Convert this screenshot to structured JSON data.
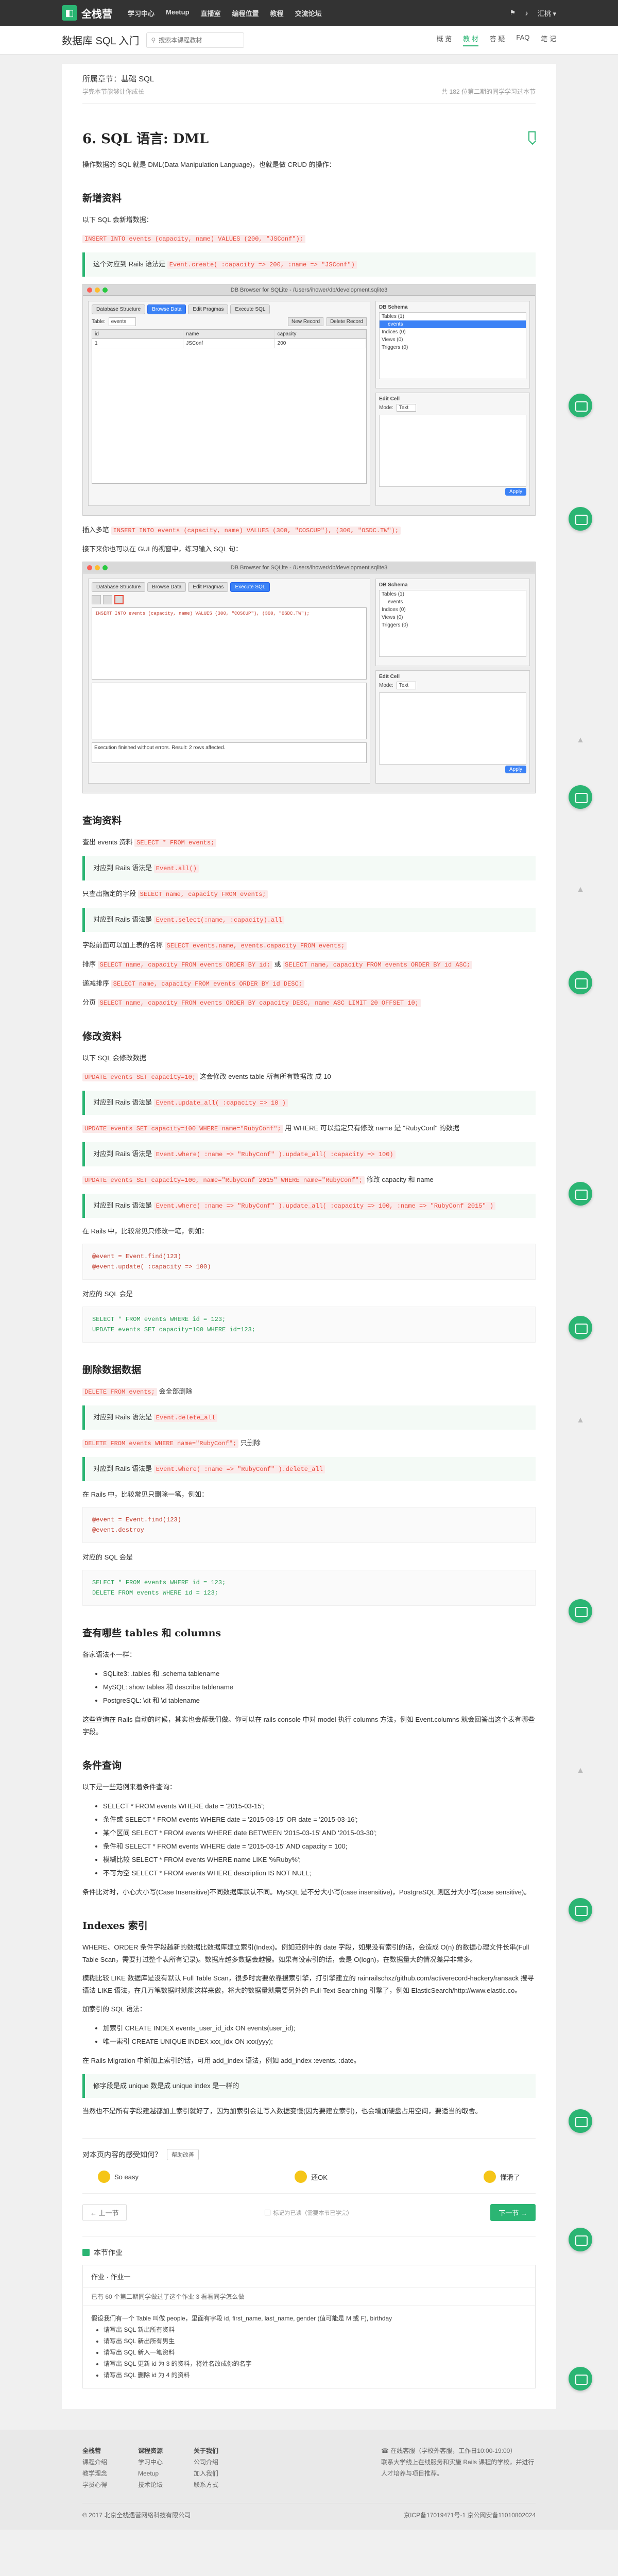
{
  "topbar": {
    "brand": "全栈营",
    "nav": [
      "学习中心",
      "Meetup",
      "直播室",
      "编程位置",
      "教程",
      "交流论坛"
    ],
    "right": [
      "⚑",
      "♪",
      "汇桃 ▾"
    ]
  },
  "subbar": {
    "course_title": "数据库 SQL 入门",
    "search_placeholder": "搜索本课程教材",
    "tabs": [
      "概 览",
      "教 材",
      "答 疑",
      "FAQ",
      "笔 记"
    ]
  },
  "chapter": {
    "name": "所属章节：基础 SQL",
    "sub": "学完本节能够让你成长",
    "stat": "共 182 位第二期的同学学习过本节"
  },
  "article": {
    "title": "6. SQL 语言: DML",
    "intro": "操作数据的 SQL 就是 DML(Data Manipulation Language)，也就是做 CRUD 的操作：",
    "s_insert": "新增资料",
    "insert_p1": "以下 SQL 会新增数据：",
    "insert_code1": "INSERT INTO events (capacity, name) VALUES (200, \"JSConf\");",
    "insert_note_pre": "这个对应到 Rails 语法是",
    "insert_note_code": "Event.create( :capacity => 200, :name => \"JSConf\")",
    "insert_p2_pre": "插入多笔",
    "insert_p2_code": "INSERT INTO events (capacity, name) VALUES (300, \"COSCUP\"), (300, \"OSDC.TW\");",
    "insert_p3": "接下来你也可以在 GUI 的视窗中，练习输入 SQL 句：",
    "s_query": "查询资料",
    "q1_pre": "查出 events 资料",
    "q1_code": "SELECT * FROM events;",
    "q2_pre": "对应到 Rails 语法是",
    "q2_code": "Event.all()",
    "q3_pre": "只查出指定的字段",
    "q3_code": "SELECT name, capacity FROM events;",
    "q4_pre": "对应到 Rails 语法是",
    "q4_code": "Event.select(:name, :capacity).all",
    "q5_pre": "字段前面可以加上表的名称",
    "q5_code": "SELECT events.name, events.capacity FROM events;",
    "q6_pre": "排序",
    "q6_code1": "SELECT name, capacity FROM events ORDER BY id;",
    "q6_mid": "或",
    "q6_code2": "SELECT name, capacity FROM events ORDER BY id ASC;",
    "q7_pre": "递减排序",
    "q7_code": "SELECT name, capacity FROM events ORDER BY id DESC;",
    "q8_pre": "分页",
    "q8_code": "SELECT name, capacity FROM events ORDER BY capacity DESC, name ASC LIMIT 20 OFFSET 10;",
    "s_update": "修改资料",
    "u1": "以下 SQL 会修改数据",
    "u2_code": "UPDATE events SET capacity=10;",
    "u2_post": "这会修改 events table 所有所有数据改 成 10",
    "u3_pre": "对应到 Rails 语法是",
    "u3_code": "Event.update_all( :capacity => 10 )",
    "u4_code": "UPDATE events SET capacity=100 WHERE name=\"RubyConf\";",
    "u4_post": "用 WHERE 可以指定只有修改 name 是 \"RubyConf\" 的数据",
    "u5_pre": "对应到 Rails 语法是",
    "u5_code": "Event.where( :name => \"RubyConf\" ).update_all( :capacity => 100)",
    "u6_code": "UPDATE events SET capacity=100, name=\"RubyConf 2015\" WHERE name=\"RubyConf\";",
    "u6_post": "修改 capacity 和 name",
    "u7_pre": "对应到 Rails 语法是",
    "u7_code": "Event.where( :name => \"RubyConf\" ).update_all( :capacity => 100, :name => \"RubyConf 2015\" )",
    "u8": "在 Rails 中，比较常见只修改一笔，例如：",
    "u8_pre": "@event = Event.find(123)\n@event.update( :capacity => 100)",
    "u9": "对应的 SQL 会是",
    "u9_pre": "SELECT * FROM events WHERE id = 123;\nUPDATE events SET capacity=100 WHERE id=123;",
    "s_delete": "删除数据数据",
    "d1_code": "DELETE FROM events;",
    "d1_post": "会全部删除",
    "d2_pre": "对应到 Rails 语法是",
    "d2_code": "Event.delete_all",
    "d3_code": "DELETE FROM events WHERE name=\"RubyConf\";",
    "d3_post": "只删除",
    "d4_pre": "对应到 Rails 语法是",
    "d4_code": "Event.where( :name => \"RubyConf\" ).delete_all",
    "d5": "在 Rails 中，比较常见只删除一笔，例如：",
    "d5_pre": "@event = Event.find(123)\n@event.destroy",
    "d6": "对应的 SQL 会是",
    "d6_pre": "SELECT * FROM events WHERE id = 123;\nDELETE FROM events WHERE id = 123;",
    "s_tables": "查有哪些 tables 和 columns",
    "t1": "各家语法不一样：",
    "t_list": [
      "SQLite3: .tables 和 .schema tablename",
      "MySQL: show tables 和 describe tablename",
      "PostgreSQL: \\dt 和 \\d tablename"
    ],
    "t2": "这些查询在 Rails 自动的时候，其实也会帮我们做。你可以在 rails console 中对 model 执行 columns 方法，例如 Event.columns 就会回答出这个表有哪些字段。",
    "s_cond": "条件查询",
    "c1": "以下是一些范例来着条件查询：",
    "c_list": [
      "SELECT * FROM events WHERE date = '2015-03-15';",
      "条件或 SELECT * FROM events WHERE date = '2015-03-15' OR date = '2015-03-16';",
      "某个区间 SELECT * FROM events WHERE date BETWEEN '2015-03-15' AND '2015-03-30';",
      "条件和 SELECT * FROM events WHERE date = '2015-03-15' AND capacity = 100;",
      "模糊比较 SELECT * FROM events WHERE name LIKE '%Ruby%';",
      "不可为空 SELECT * FROM events WHERE description IS NOT NULL;"
    ],
    "c2": "条件比对时，小心大小写(Case Insensitive)不同数据库默认不同。MySQL 是不分大小写(case insensitive)，PostgreSQL 则区分大小写(case sensitive)。",
    "s_index": "Indexes 索引",
    "i1": "WHERE、ORDER 条件字段越新的数据比数据库建立索引(Index)。例如范例中的 date 字段，如果没有索引的话，会造成 O(n) 的数据心理文件长串(Full Table Scan，需要打过整个表所有记录)。数据库越多数据会越慢。如果有设索引的话，会是 O(logn)，在数据量大的情况差异非常多。",
    "i2": "模糊比较 LIKE 数据库是没有默认 Full Table Scan，很多时需要依靠搜索引擎，打引擎建立的 rainrailschxz/github.com/activerecord-hackery/ransack 搜寻语法 LIKE 语法，在几万笔数据时就能这样来做，将大的数据量就需要另外的 Full-Text Searching 引擎了，例如 ElasticSearch/http://www.elastic.co。",
    "i3": "加索引的 SQL 语法：",
    "i_list": [
      "加索引 CREATE INDEX events_user_id_idx ON events(user_id);",
      "唯一索引 CREATE UNIQUE INDEX xxx_idx ON xxx(yyy);"
    ],
    "i4": "在 Rails Migration 中新加上索引的话，可用 add_index 语法，例如 add_index :events, :date。",
    "i5_note": "修字段是成 unique 数是成 unique index 是一样的",
    "i6": "当然也不是所有字段建越都加上索引就好了，因为加索引会让写入数据变慢(因为要建立索引)，也会增加硬盘占用空间，要适当的取舍。"
  },
  "feedback": {
    "question": "对本页内容的感受如何？",
    "tag": "帮助改善",
    "options": [
      "So easy",
      "还OK",
      "懂滑了"
    ]
  },
  "pager": {
    "prev": "← 上一节",
    "mid": "标记为已读（需要本节已学完）",
    "next": "下一节 →"
  },
  "homework": {
    "header": "本节作业",
    "title": "作业 · 作业一",
    "meta": "已有 60 个第二期同学做过了这个作业   3 看看同学怎么做",
    "body": "假设我们有一个 Table 叫做 people，里面有字段 id, first_name, last_name, gender (值可能是 M 或 F), birthday",
    "list": [
      "请写出 SQL 新出所有资料",
      "请写出 SQL 新出所有男生",
      "请写出 SQL 新入一笔资料",
      "请写出 SQL 更新 id 为 3 的资料，将姓名改成你的名字",
      "请写出 SQL 删除 id 为 4 的资料"
    ]
  },
  "footer": {
    "cols": [
      {
        "h": "全栈营",
        "items": [
          "课程介绍",
          "教学理念",
          "学员心得"
        ]
      },
      {
        "h": "课程资源",
        "items": [
          "学习中心",
          "Meetup",
          "技术论坛"
        ]
      },
      {
        "h": "关于我们",
        "items": [
          "公司介绍",
          "加入我们",
          "联系方式"
        ]
      }
    ],
    "contact": [
      "☎ 在线客服（学校外客服，工作日10:00-19:00）",
      "联系大学线上在线服务和实施 Rails 课程的学校，并进行人才培养与项目推荐。"
    ],
    "copyright": "© 2017 北京全栈遇营网络科技有限公司",
    "icp": "京ICP备17019471号-1  京公网安备11010802024"
  },
  "screenshot1": {
    "window_title": "DB Browser for SQLite - /Users/ihower/db/development.sqlite3",
    "tabs": [
      "Database Structure",
      "Browse Data",
      "Edit Pragmas",
      "Execute SQL"
    ],
    "active_tab": "Browse Data",
    "table_label": "Table:",
    "table_value": "events",
    "buttons": [
      "New Record",
      "Delete Record"
    ],
    "columns": [
      "id",
      "name",
      "capacity"
    ],
    "rows": [
      [
        "1",
        "JSConf",
        "200"
      ]
    ],
    "db_schema": "DB Schema",
    "tree": [
      "Tables (1)",
      "events",
      "Indices (0)",
      "Views (0)",
      "Triggers (0)"
    ],
    "edit_cell": "Edit Cell",
    "mode_label": "Mode:",
    "mode_value": "Text",
    "apply": "Apply"
  },
  "screenshot2": {
    "window_title": "DB Browser for SQLite - /Users/ihower/db/development.sqlite3",
    "active_tab": "Execute SQL",
    "sql_text": "INSERT INTO events (capacity, name) VALUES (300, \"COSCUP\"), (300, \"OSDC.TW\");",
    "result": "Execution finished without errors. Result: 2 rows affected."
  }
}
